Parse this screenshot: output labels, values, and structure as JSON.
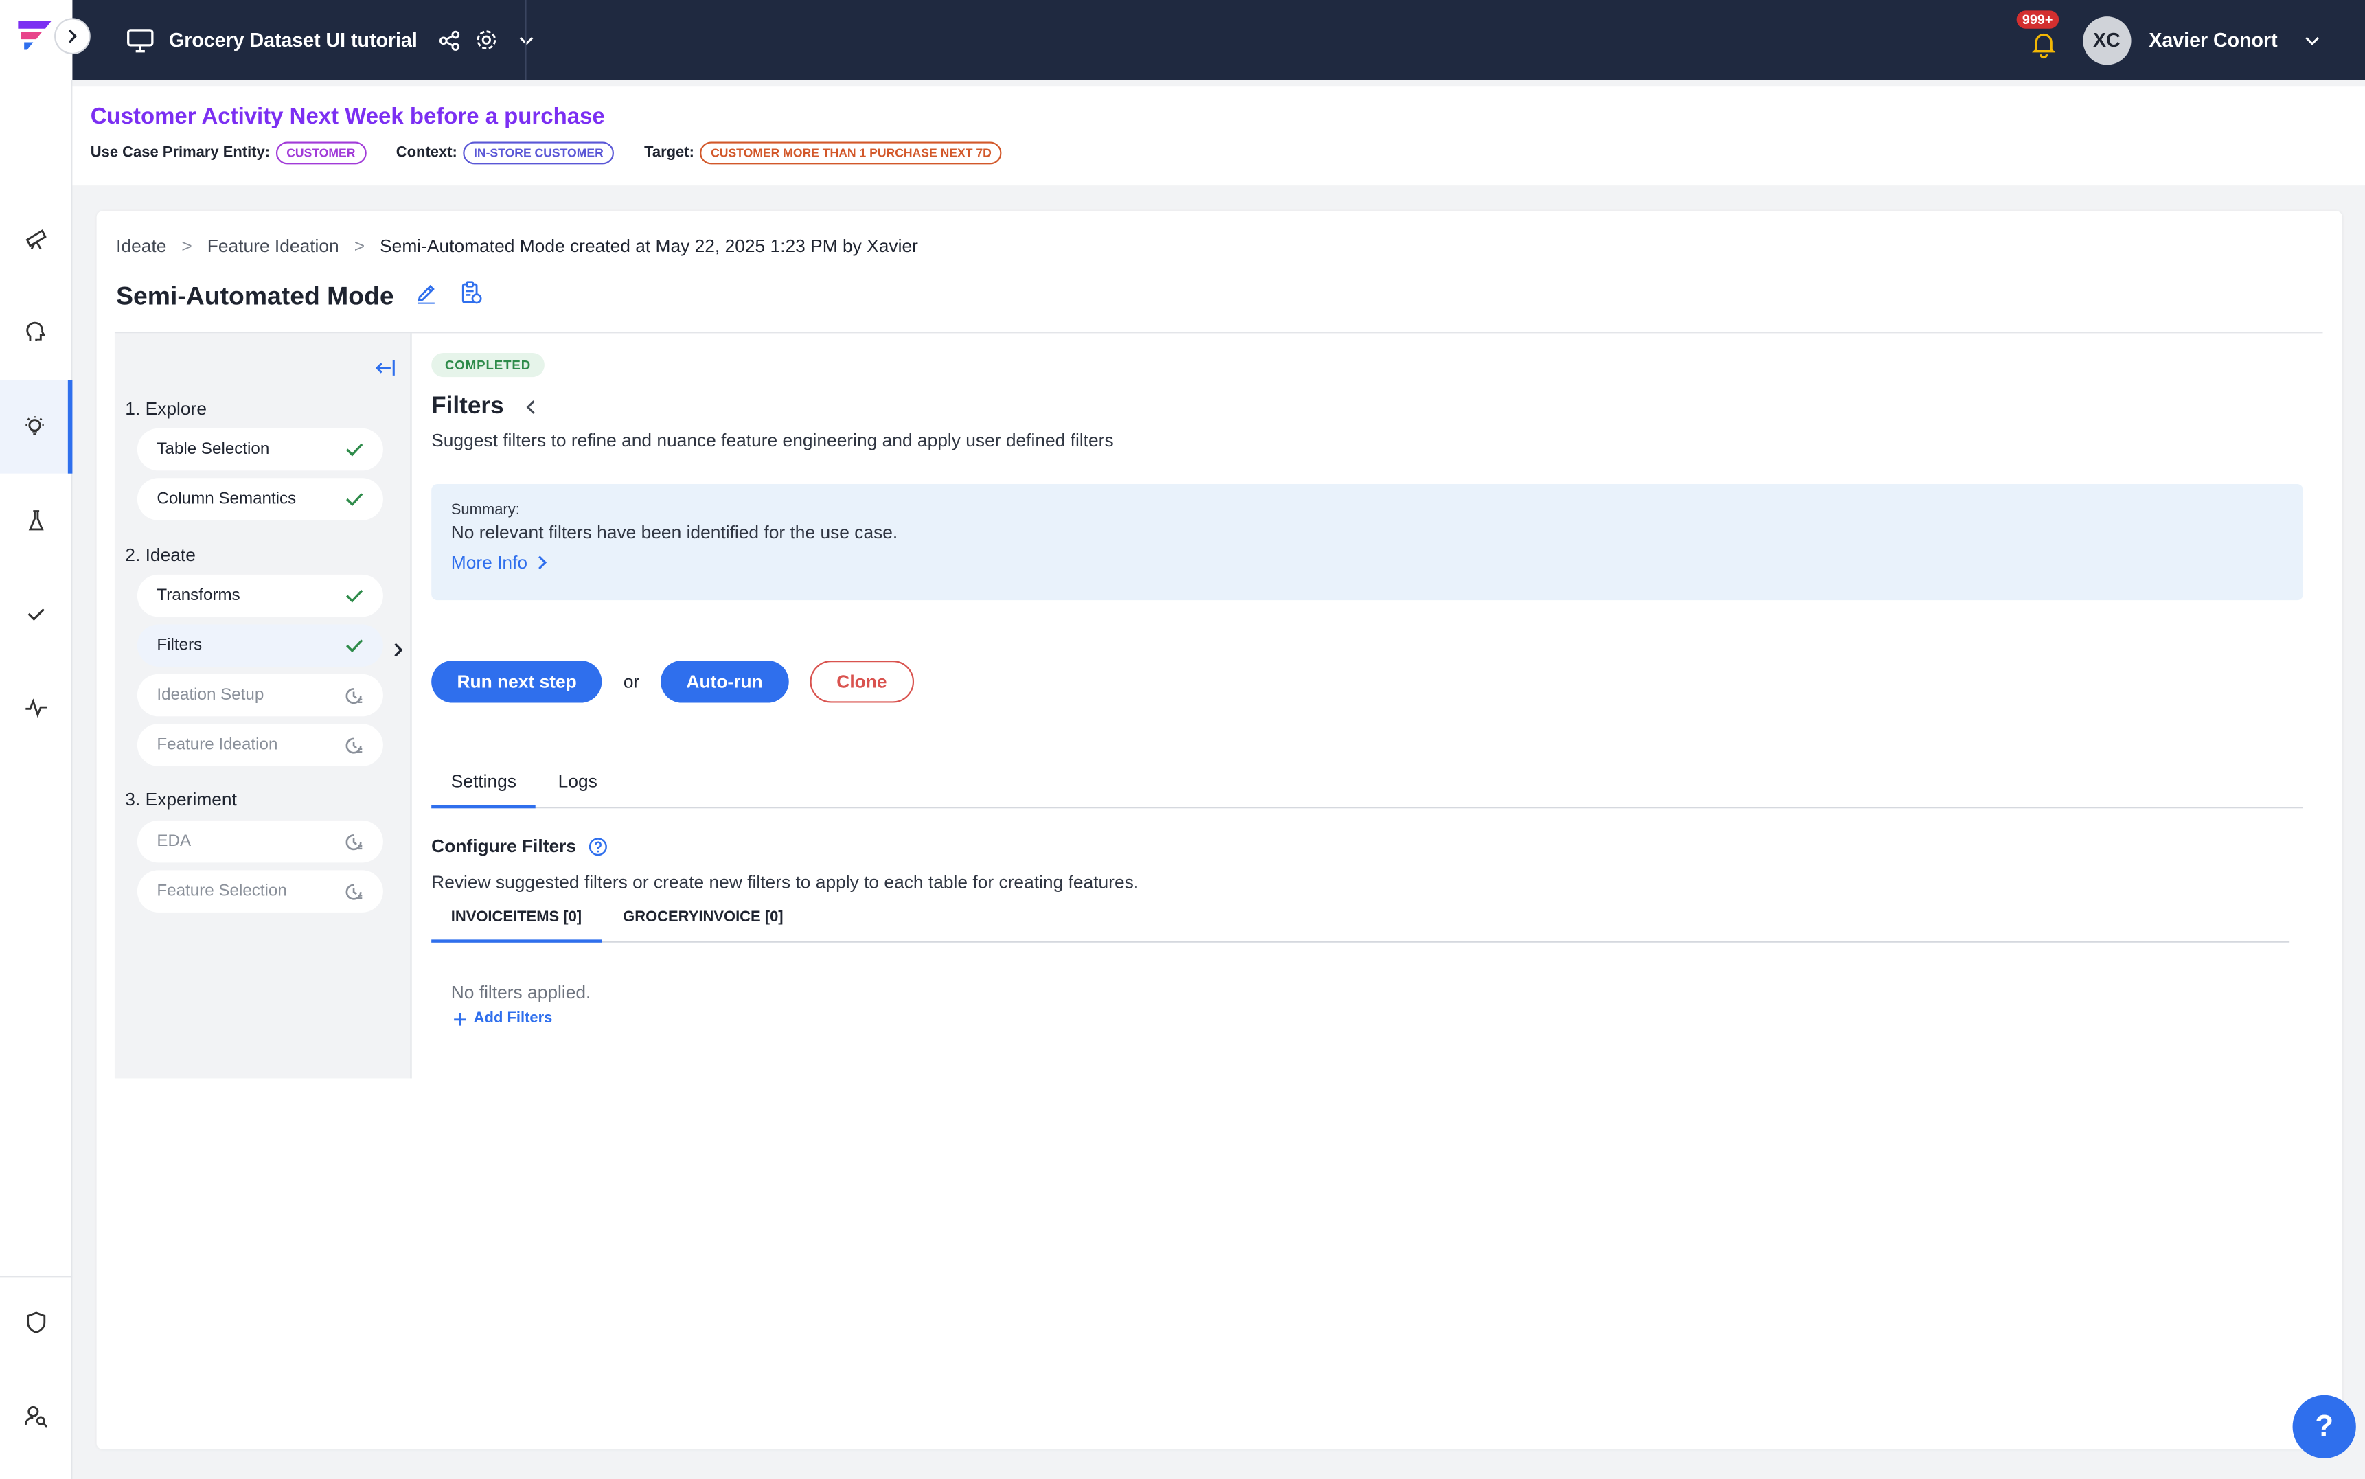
{
  "topbar": {
    "project_name": "Grocery Dataset UI tutorial",
    "notification_count": "999+",
    "user_initials": "XC",
    "user_name": "Xavier Conort"
  },
  "use_case": {
    "title": "Customer Activity Next Week before a purchase",
    "entity_label": "Use Case Primary Entity:",
    "entity_value": "CUSTOMER",
    "context_label": "Context:",
    "context_value": "IN-STORE CUSTOMER",
    "target_label": "Target:",
    "target_value": "CUSTOMER MORE THAN 1 PURCHASE NEXT 7D"
  },
  "breadcrumb": {
    "items": [
      "Ideate",
      "Feature Ideation"
    ],
    "current": "Semi-Automated Mode created at May 22, 2025 1:23 PM by Xavier",
    "separator": ">"
  },
  "page": {
    "title": "Semi-Automated Mode"
  },
  "steps": {
    "groups": [
      {
        "label": "1. Explore",
        "items": [
          {
            "label": "Table Selection",
            "status": "done"
          },
          {
            "label": "Column Semantics",
            "status": "done"
          }
        ]
      },
      {
        "label": "2. Ideate",
        "items": [
          {
            "label": "Transforms",
            "status": "done"
          },
          {
            "label": "Filters",
            "status": "done"
          },
          {
            "label": "Ideation Setup",
            "status": "pending"
          },
          {
            "label": "Feature Ideation",
            "status": "pending"
          }
        ]
      },
      {
        "label": "3. Experiment",
        "items": [
          {
            "label": "EDA",
            "status": "pending"
          },
          {
            "label": "Feature Selection",
            "status": "pending"
          }
        ]
      }
    ]
  },
  "content": {
    "status": "COMPLETED",
    "title": "Filters",
    "description": "Suggest filters to refine and nuance feature engineering and apply user defined filters",
    "summary_label": "Summary:",
    "summary_text": "No relevant filters have been identified for the use case.",
    "more_info": "More Info",
    "run_next_step": "Run next step",
    "or_text": "or",
    "auto_run": "Auto-run",
    "clone": "Clone",
    "tabs": [
      "Settings",
      "Logs"
    ],
    "config_title": "Configure Filters",
    "config_desc": "Review suggested filters or create new filters to apply to each table for creating features.",
    "subtabs": [
      "INVOICEITEMS [0]",
      "GROCERYINVOICE [0]"
    ],
    "no_filters": "No filters applied.",
    "add_filters": "Add Filters"
  },
  "help": {
    "label": "?"
  },
  "colors": {
    "accent": "#2f6fed",
    "title_purple": "#7b2ff2",
    "topbar": "#1f2940",
    "success": "#2e8b4a",
    "danger": "#d9534f"
  }
}
